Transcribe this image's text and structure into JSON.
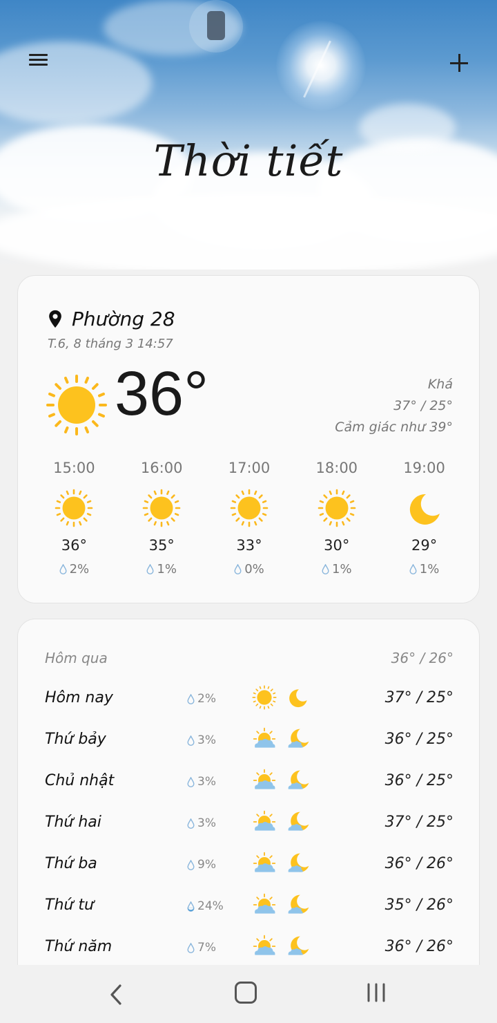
{
  "app": {
    "title": "Thời tiết"
  },
  "header": {
    "menu_icon": "hamburger-menu-icon",
    "add_icon": "plus-icon"
  },
  "current": {
    "location": "Phường 28",
    "location_icon": "location-pin-icon",
    "datetime": "T.6, 8 tháng 3 14:57",
    "temperature": "36°",
    "condition": "Khá",
    "high_low": "37° / 25°",
    "feels_like": "Cảm giác như 39°",
    "icon": "sun-icon"
  },
  "hourly": [
    {
      "time": "15:00",
      "temp": "36°",
      "rain": "2%",
      "icon": "sun-icon"
    },
    {
      "time": "16:00",
      "temp": "35°",
      "rain": "1%",
      "icon": "sun-icon"
    },
    {
      "time": "17:00",
      "temp": "33°",
      "rain": "0%",
      "icon": "sun-icon"
    },
    {
      "time": "18:00",
      "temp": "30°",
      "rain": "1%",
      "icon": "sun-icon"
    },
    {
      "time": "19:00",
      "temp": "29°",
      "rain": "1%",
      "icon": "moon-icon"
    }
  ],
  "daily": {
    "yesterday": {
      "label": "Hôm qua",
      "temps": "36° / 26°"
    },
    "days": [
      {
        "name": "Hôm nay",
        "rain": "2%",
        "temps": "37° / 25°",
        "day_icon": "sun-icon",
        "night_icon": "moon-icon"
      },
      {
        "name": "Thứ bảy",
        "rain": "3%",
        "temps": "36° / 25°",
        "day_icon": "partly-cloudy-icon",
        "night_icon": "partly-cloudy-night-icon"
      },
      {
        "name": "Chủ nhật",
        "rain": "3%",
        "temps": "36° / 25°",
        "day_icon": "partly-cloudy-icon",
        "night_icon": "partly-cloudy-night-icon"
      },
      {
        "name": "Thứ hai",
        "rain": "3%",
        "temps": "37° / 25°",
        "day_icon": "partly-cloudy-icon",
        "night_icon": "partly-cloudy-night-icon"
      },
      {
        "name": "Thứ ba",
        "rain": "9%",
        "temps": "36° / 26°",
        "day_icon": "partly-cloudy-icon",
        "night_icon": "partly-cloudy-night-icon"
      },
      {
        "name": "Thứ tư",
        "rain": "24%",
        "temps": "35° / 26°",
        "day_icon": "partly-cloudy-icon",
        "night_icon": "partly-cloudy-night-icon"
      },
      {
        "name": "Thứ năm",
        "rain": "7%",
        "temps": "36° / 26°",
        "day_icon": "partly-cloudy-icon",
        "night_icon": "partly-cloudy-night-icon"
      }
    ]
  },
  "navbar": {
    "back_icon": "back-chevron-icon",
    "home_icon": "home-icon",
    "recent_icon": "recent-apps-icon"
  },
  "colors": {
    "sun": "#fbb81c",
    "sun_core": "#fdc21e",
    "cloud": "#8fc4ea",
    "drop": "#8ab6dc"
  }
}
